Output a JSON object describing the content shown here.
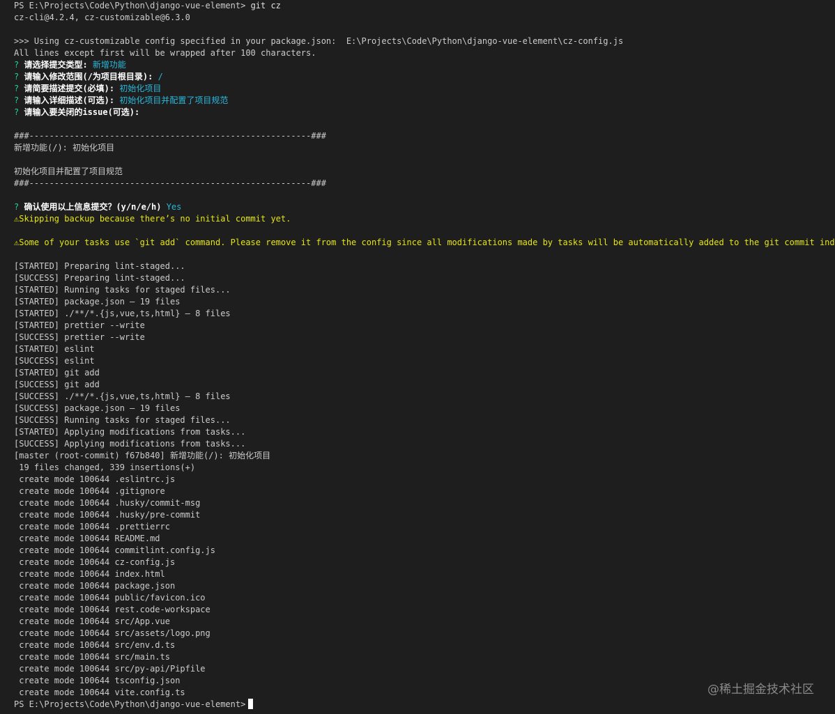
{
  "terminal": {
    "lines": [
      {
        "segs": [
          {
            "t": "PS E:\\Projects\\Code\\Python\\django-vue-element> "
          },
          {
            "t": "git cz",
            "c": "w"
          }
        ]
      },
      {
        "segs": [
          {
            "t": "cz-cli@4.2.4, cz-customizable@6.3.0"
          }
        ]
      },
      {
        "segs": [
          {
            "t": ""
          }
        ]
      },
      {
        "segs": [
          {
            "t": ">>> Using cz-customizable config specified in your package.json:  E:\\Projects\\Code\\Python\\django-vue-element\\cz-config.js"
          }
        ]
      },
      {
        "segs": [
          {
            "t": "All lines except first will be wrapped after 100 characters."
          }
        ]
      },
      {
        "segs": [
          {
            "t": "? ",
            "c": "q"
          },
          {
            "t": "请选择提交类型:",
            "c": "b"
          },
          {
            "t": " 新增功能",
            "c": "c"
          }
        ]
      },
      {
        "segs": [
          {
            "t": "? ",
            "c": "q"
          },
          {
            "t": "请输入修改范围(/为项目根目录):",
            "c": "b"
          },
          {
            "t": " /",
            "c": "c"
          }
        ]
      },
      {
        "segs": [
          {
            "t": "? ",
            "c": "q"
          },
          {
            "t": "请简要描述提交(必填):",
            "c": "b"
          },
          {
            "t": " 初始化项目",
            "c": "c"
          }
        ]
      },
      {
        "segs": [
          {
            "t": "? ",
            "c": "q"
          },
          {
            "t": "请输入详细描述(可选):",
            "c": "b"
          },
          {
            "t": " 初始化项目并配置了项目规范",
            "c": "c"
          }
        ]
      },
      {
        "segs": [
          {
            "t": "? ",
            "c": "q"
          },
          {
            "t": "请输入要关闭的issue(可选):",
            "c": "b"
          }
        ]
      },
      {
        "segs": [
          {
            "t": ""
          }
        ]
      },
      {
        "segs": [
          {
            "t": "###--------------------------------------------------------###"
          }
        ]
      },
      {
        "segs": [
          {
            "t": "新增功能(/): 初始化项目"
          }
        ]
      },
      {
        "segs": [
          {
            "t": ""
          }
        ]
      },
      {
        "segs": [
          {
            "t": "初始化项目并配置了项目规范"
          }
        ]
      },
      {
        "segs": [
          {
            "t": "###--------------------------------------------------------###"
          }
        ]
      },
      {
        "segs": [
          {
            "t": ""
          }
        ]
      },
      {
        "segs": [
          {
            "t": "? ",
            "c": "q"
          },
          {
            "t": "确认使用以上信息提交？(y/n/e/h)",
            "c": "b"
          },
          {
            "t": " Yes",
            "c": "c"
          }
        ]
      },
      {
        "segs": [
          {
            "t": "⚠Skipping backup because there’s no initial commit yet.",
            "c": "y"
          }
        ]
      },
      {
        "segs": [
          {
            "t": ""
          }
        ]
      },
      {
        "segs": [
          {
            "t": "⚠Some of your tasks use `git add` command. Please remove it from the config since all modifications made by tasks will be automatically added to the git commit index.",
            "c": "y"
          }
        ]
      },
      {
        "segs": [
          {
            "t": ""
          }
        ]
      },
      {
        "segs": [
          {
            "t": "[STARTED] Preparing lint-staged..."
          }
        ]
      },
      {
        "segs": [
          {
            "t": "[SUCCESS] Preparing lint-staged..."
          }
        ]
      },
      {
        "segs": [
          {
            "t": "[STARTED] Running tasks for staged files..."
          }
        ]
      },
      {
        "segs": [
          {
            "t": "[STARTED] package.json — 19 files"
          }
        ]
      },
      {
        "segs": [
          {
            "t": "[STARTED] ./**/*.{js,vue,ts,html} — 8 files"
          }
        ]
      },
      {
        "segs": [
          {
            "t": "[STARTED] prettier --write"
          }
        ]
      },
      {
        "segs": [
          {
            "t": "[SUCCESS] prettier --write"
          }
        ]
      },
      {
        "segs": [
          {
            "t": "[STARTED] eslint"
          }
        ]
      },
      {
        "segs": [
          {
            "t": "[SUCCESS] eslint"
          }
        ]
      },
      {
        "segs": [
          {
            "t": "[STARTED] git add"
          }
        ]
      },
      {
        "segs": [
          {
            "t": "[SUCCESS] git add"
          }
        ]
      },
      {
        "segs": [
          {
            "t": "[SUCCESS] ./**/*.{js,vue,ts,html} — 8 files"
          }
        ]
      },
      {
        "segs": [
          {
            "t": "[SUCCESS] package.json — 19 files"
          }
        ]
      },
      {
        "segs": [
          {
            "t": "[SUCCESS] Running tasks for staged files..."
          }
        ]
      },
      {
        "segs": [
          {
            "t": "[STARTED] Applying modifications from tasks..."
          }
        ]
      },
      {
        "segs": [
          {
            "t": "[SUCCESS] Applying modifications from tasks..."
          }
        ]
      },
      {
        "segs": [
          {
            "t": "[master (root-commit) f67b840] 新增功能(/): 初始化项目"
          }
        ]
      },
      {
        "segs": [
          {
            "t": " 19 files changed, 339 insertions(+)"
          }
        ]
      },
      {
        "segs": [
          {
            "t": " create mode 100644 .eslintrc.js"
          }
        ]
      },
      {
        "segs": [
          {
            "t": " create mode 100644 .gitignore"
          }
        ]
      },
      {
        "segs": [
          {
            "t": " create mode 100644 .husky/commit-msg"
          }
        ]
      },
      {
        "segs": [
          {
            "t": " create mode 100644 .husky/pre-commit"
          }
        ]
      },
      {
        "segs": [
          {
            "t": " create mode 100644 .prettierrc"
          }
        ]
      },
      {
        "segs": [
          {
            "t": " create mode 100644 README.md"
          }
        ]
      },
      {
        "segs": [
          {
            "t": " create mode 100644 commitlint.config.js"
          }
        ]
      },
      {
        "segs": [
          {
            "t": " create mode 100644 cz-config.js"
          }
        ]
      },
      {
        "segs": [
          {
            "t": " create mode 100644 index.html"
          }
        ]
      },
      {
        "segs": [
          {
            "t": " create mode 100644 package.json"
          }
        ]
      },
      {
        "segs": [
          {
            "t": " create mode 100644 public/favicon.ico"
          }
        ]
      },
      {
        "segs": [
          {
            "t": " create mode 100644 rest.code-workspace"
          }
        ]
      },
      {
        "segs": [
          {
            "t": " create mode 100644 src/App.vue"
          }
        ]
      },
      {
        "segs": [
          {
            "t": " create mode 100644 src/assets/logo.png"
          }
        ]
      },
      {
        "segs": [
          {
            "t": " create mode 100644 src/env.d.ts"
          }
        ]
      },
      {
        "segs": [
          {
            "t": " create mode 100644 src/main.ts"
          }
        ]
      },
      {
        "segs": [
          {
            "t": " create mode 100644 src/py-api/Pipfile"
          }
        ]
      },
      {
        "segs": [
          {
            "t": " create mode 100644 tsconfig.json"
          }
        ]
      },
      {
        "segs": [
          {
            "t": " create mode 100644 vite.config.ts"
          }
        ]
      }
    ],
    "prompt": "PS E:\\Projects\\Code\\Python\\django-vue-element>"
  },
  "watermark": "@稀土掘金技术社区",
  "colors": {
    "background": "#1e1e1e",
    "text": "#cccccc",
    "question_mark": "#23d18b",
    "answer": "#29b8db",
    "warning": "#e5e510"
  }
}
